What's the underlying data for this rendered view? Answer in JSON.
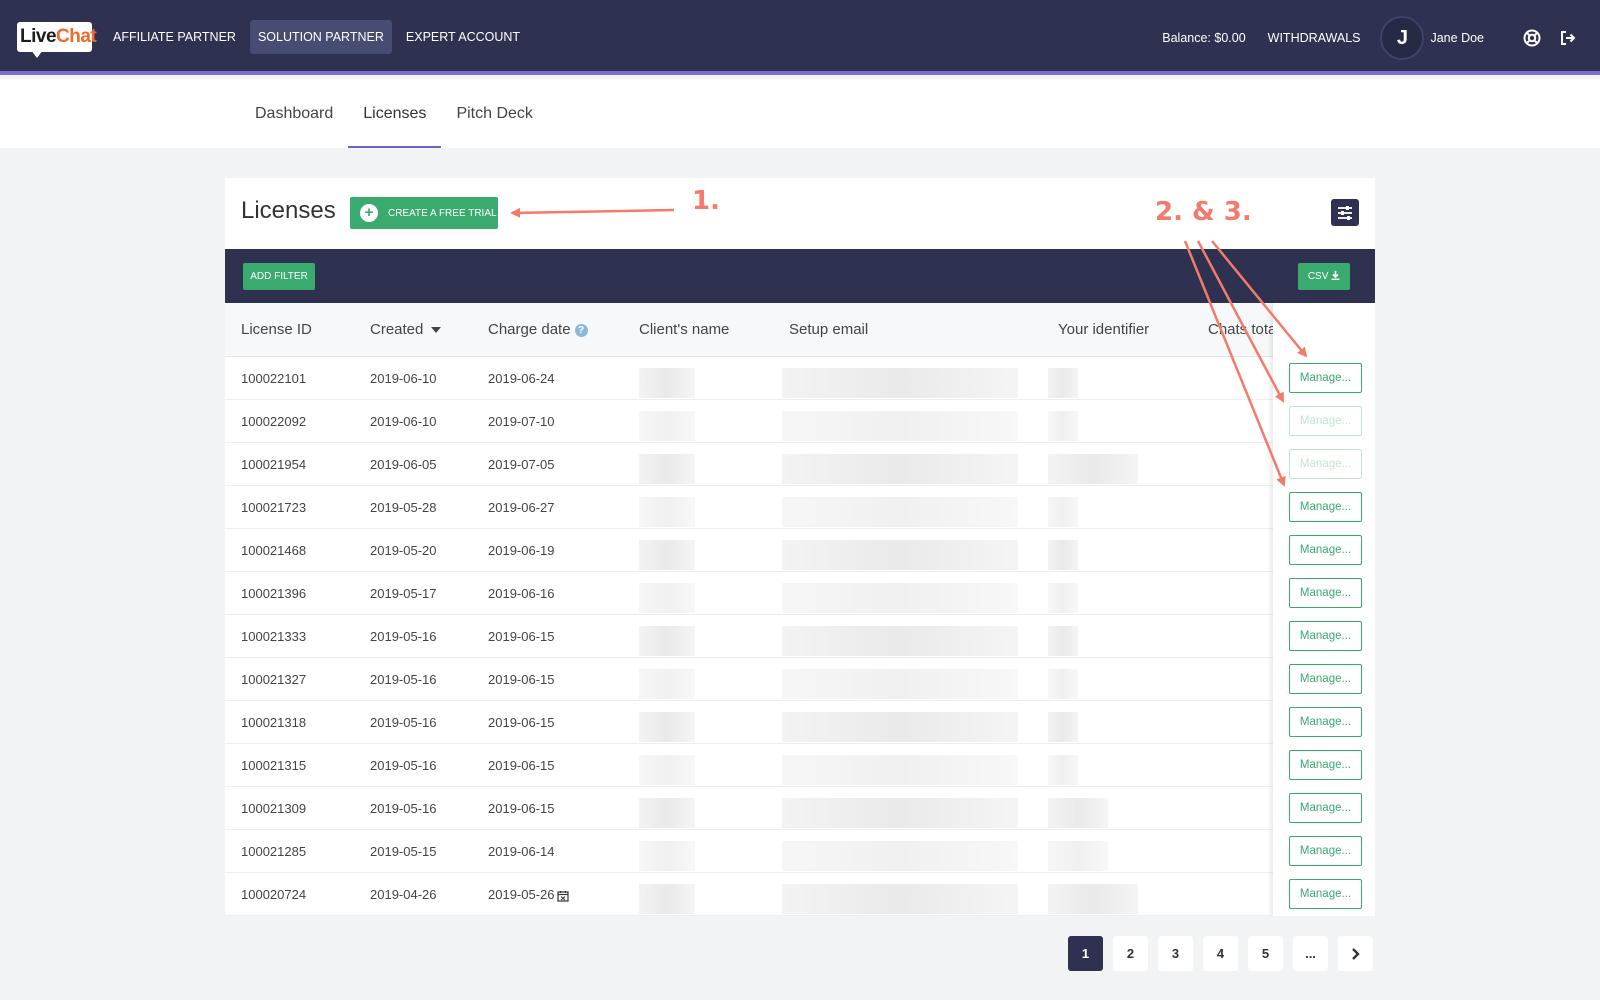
{
  "brand": {
    "logo_live": "Live",
    "logo_chat": "Chat"
  },
  "top_nav": {
    "items": [
      {
        "label": "AFFILIATE PARTNER",
        "active": false
      },
      {
        "label": "SOLUTION PARTNER",
        "active": true
      },
      {
        "label": "EXPERT ACCOUNT",
        "active": false
      }
    ],
    "balance": "Balance: $0.00",
    "withdrawals": "WITHDRAWALS",
    "avatar_initial": "J",
    "user_name": "Jane Doe",
    "icons": [
      "support-icon",
      "logout-icon"
    ]
  },
  "sub_nav": {
    "tabs": [
      {
        "label": "Dashboard",
        "active": false
      },
      {
        "label": "Licenses",
        "active": true
      },
      {
        "label": "Pitch Deck",
        "active": false
      }
    ]
  },
  "licenses": {
    "title": "Licenses",
    "create_trial_label": "CREATE A FREE TRIAL",
    "add_filter_label": "ADD FILTER",
    "csv_label": "CSV",
    "columns": [
      "License ID",
      "Created",
      "Charge date",
      "Client's name",
      "Setup email",
      "Your identifier",
      "Chats tota"
    ],
    "rows": [
      {
        "id": "100022101",
        "created": "2019-06-10",
        "charge": "2019-06-24",
        "manage": "Manage...",
        "disabled": false
      },
      {
        "id": "100022092",
        "created": "2019-06-10",
        "charge": "2019-07-10",
        "manage": "Manage...",
        "disabled": true
      },
      {
        "id": "100021954",
        "created": "2019-06-05",
        "charge": "2019-07-05",
        "manage": "Manage...",
        "disabled": true
      },
      {
        "id": "100021723",
        "created": "2019-05-28",
        "charge": "2019-06-27",
        "manage": "Manage...",
        "disabled": false
      },
      {
        "id": "100021468",
        "created": "2019-05-20",
        "charge": "2019-06-19",
        "manage": "Manage...",
        "disabled": false
      },
      {
        "id": "100021396",
        "created": "2019-05-17",
        "charge": "2019-06-16",
        "manage": "Manage...",
        "disabled": false
      },
      {
        "id": "100021333",
        "created": "2019-05-16",
        "charge": "2019-06-15",
        "manage": "Manage...",
        "disabled": false
      },
      {
        "id": "100021327",
        "created": "2019-05-16",
        "charge": "2019-06-15",
        "manage": "Manage...",
        "disabled": false
      },
      {
        "id": "100021318",
        "created": "2019-05-16",
        "charge": "2019-06-15",
        "manage": "Manage...",
        "disabled": false
      },
      {
        "id": "100021315",
        "created": "2019-05-16",
        "charge": "2019-06-15",
        "manage": "Manage...",
        "disabled": false
      },
      {
        "id": "100021309",
        "created": "2019-05-16",
        "charge": "2019-06-15",
        "manage": "Manage...",
        "disabled": false
      },
      {
        "id": "100021285",
        "created": "2019-05-15",
        "charge": "2019-06-14",
        "manage": "Manage...",
        "disabled": false
      },
      {
        "id": "100020724",
        "created": "2019-04-26",
        "charge": "2019-05-26",
        "manage": "Manage...",
        "disabled": false
      }
    ]
  },
  "pagination": {
    "pages": [
      "1",
      "2",
      "3",
      "4",
      "5",
      "..."
    ],
    "active": "1"
  },
  "annotations": {
    "first": "1.",
    "second": "2. & 3."
  },
  "colors": {
    "nav_bg": "#2e3250",
    "accent": "#7b6fd6",
    "green": "#3aaa6f",
    "annotation": "#f47a6a"
  }
}
